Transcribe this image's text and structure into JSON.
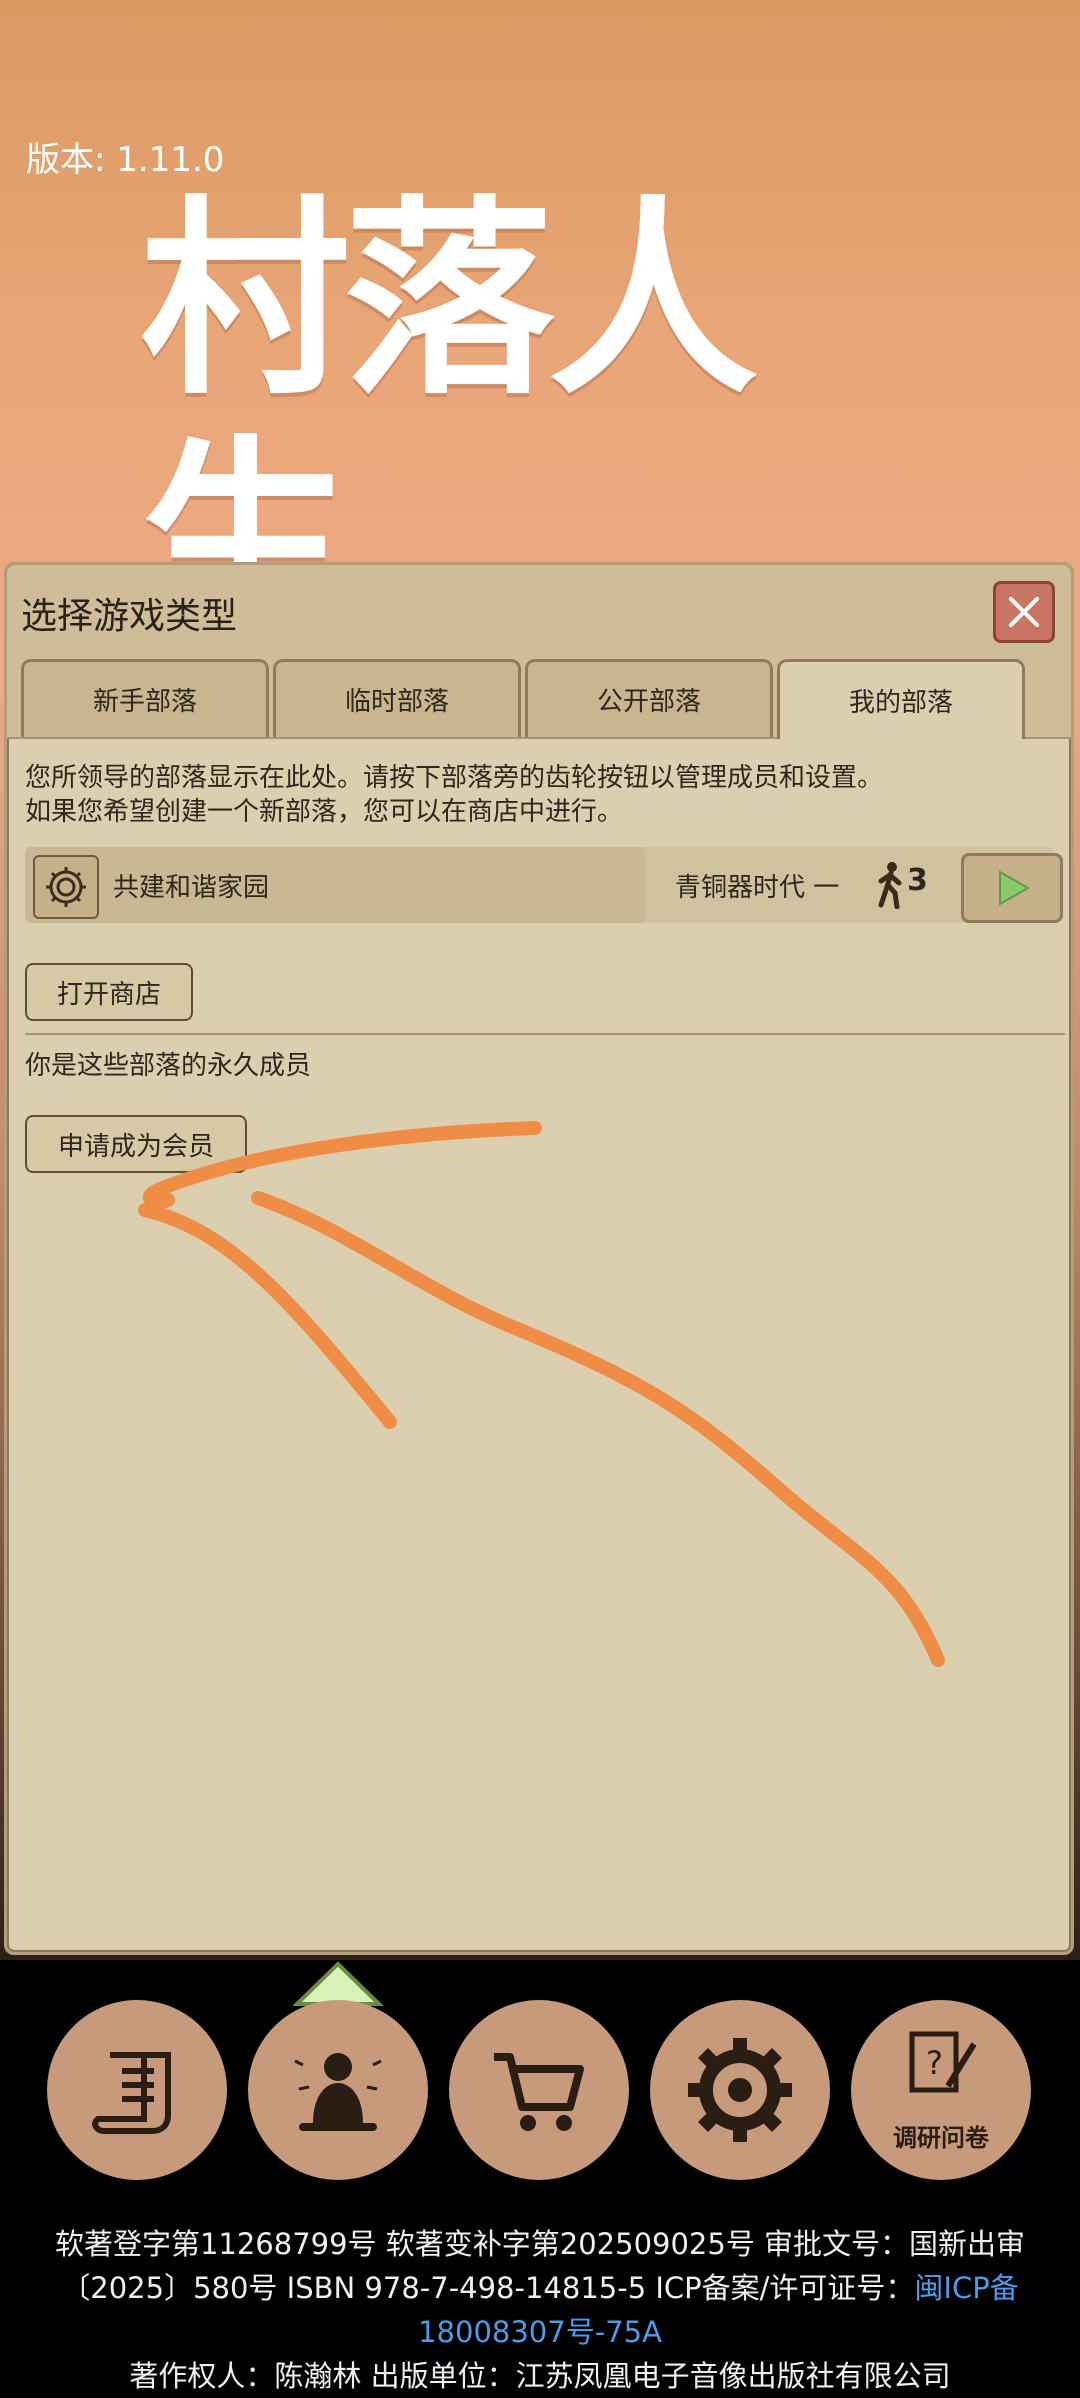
{
  "version_label": "版本: 1.11.0",
  "logo_text": "村落人生",
  "dialog": {
    "title": "选择游戏类型",
    "tabs": [
      "新手部落",
      "临时部落",
      "公开部落",
      "我的部落"
    ],
    "active_tab": "我的部落",
    "description_line1": "您所领导的部落显示在此处。请按下部落旁的齿轮按钮以管理成员和设置。",
    "description_line2": "如果您希望创建一个新部落，您可以在商店中进行。",
    "tribe": {
      "name": "共建和谐家园",
      "era": "青铜器时代 一",
      "member_count": "3"
    },
    "open_shop_label": "打开商店",
    "member_text": "你是这些部落的永久成员",
    "apply_member_label": "申请成为会员"
  },
  "bottom_nav": {
    "items": [
      "scroll-icon",
      "meditate-icon",
      "cart-icon",
      "settings-icon",
      "survey-icon"
    ],
    "survey_label": "调研问卷"
  },
  "footer": {
    "line1": "软著登字第11268799号 软著变补字第202509025号 审批文号：国新出审",
    "line2_pre": "〔2025〕580号 ISBN 978-7-498-14815-5 ICP备案/许可证号：",
    "line2_link": "闽ICP备",
    "line3_link": "18008307号-75A",
    "line4": "著作权人：陈瀚林 出版单位：江苏凤凰电子音像出版社有限公司"
  },
  "colors": {
    "panel_bg": "#dccfb0",
    "close_red": "#c87564",
    "scribble": "#ef8c46",
    "link_blue": "#4c9be8"
  }
}
